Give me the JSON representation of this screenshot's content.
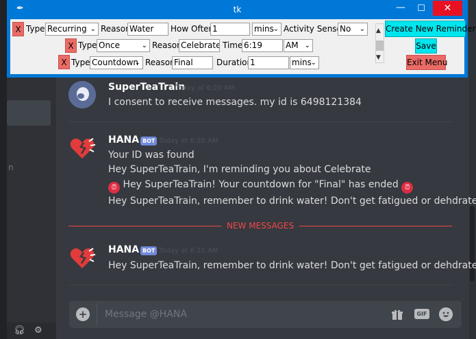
{
  "tk_window": {
    "title": "tk",
    "icon": "feather-icon",
    "controls": {
      "minimize": "—",
      "maximize": "☐",
      "close": "✕"
    },
    "remove_label": "X",
    "rows": [
      {
        "type_label": "Type",
        "type_value": "Recurring",
        "reason_label": "Reason",
        "reason_value": "Water",
        "field_label": "How Often",
        "field_value": "1",
        "unit_value": "mins",
        "sensor_label": "Activity Sensor",
        "sensor_value": "No"
      },
      {
        "type_label": "Type",
        "type_value": "Once",
        "reason_label": "Reason",
        "reason_value": "Celebrate",
        "field_label": "Time",
        "field_value": "6:19",
        "unit_value": "AM"
      },
      {
        "type_label": "Type",
        "type_value": "Countdown",
        "reason_label": "Reason",
        "reason_value": "Final",
        "field_label": "Duration",
        "field_value": "1",
        "unit_value": "mins"
      }
    ],
    "buttons": {
      "create": "Create New Reminder",
      "save": "Save",
      "exit": "Exit Menu"
    },
    "colors": {
      "accent": "#0078d7",
      "cyan_button": "#00e5ee",
      "red_button": "#ea6b66"
    }
  },
  "sidebar": {
    "channel_fragment": "n"
  },
  "messages": [
    {
      "author": "SuperTeaTrain",
      "bot": false,
      "timestamp": "Today at 6:20 AM",
      "lines": [
        "I consent to receive messages. my id is 6498121384"
      ]
    },
    {
      "author": "HANA",
      "bot": true,
      "badge": "BOT",
      "timestamp": "Today at 6:20 AM",
      "lines": [
        "Your ID was found",
        "Hey SuperTeaTrain, I'm reminding you about Celebrate",
        "Hey SuperTeaTrain! Your countdown for \"Final\" has ended",
        "Hey SuperTeaTrain, remember to drink water! Don't get fatigued or dehdrated"
      ]
    },
    {
      "author": "HANA",
      "bot": true,
      "badge": "BOT",
      "timestamp": "Today at 6:21 AM",
      "lines": [
        "Hey SuperTeaTrain, remember to drink water! Don't get fatigued or dehdrated"
      ]
    }
  ],
  "new_messages_label": "NEW MESSAGES",
  "composer": {
    "placeholder": "Message @HANA",
    "gif_label": "GIF"
  },
  "icons": [
    "headphones-icon",
    "settings-icon",
    "gift-icon",
    "gif-icon",
    "emoji-icon",
    "alarm-clock-icon",
    "add-attachment-icon"
  ],
  "colors": {
    "discord_bg": "#36393f",
    "new_messages": "#f04747",
    "bot_badge": "#7289da"
  }
}
